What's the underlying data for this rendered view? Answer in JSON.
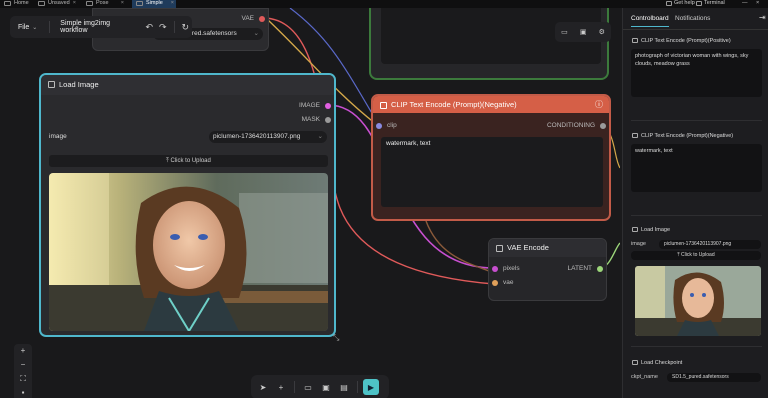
{
  "tabs": [
    {
      "label": "Home",
      "active": false
    },
    {
      "label": "Unsaved",
      "active": false
    },
    {
      "label": "Pose",
      "active": false
    },
    {
      "label": "Simple",
      "active": true
    }
  ],
  "top_right": {
    "help": "Get help",
    "terminal": "Terminal"
  },
  "menu": {
    "file_label": "File",
    "workflow_name": "Simple img2img workflow"
  },
  "checkpoint_node": {
    "vae_label": "VAE",
    "ckpt_label": "ckpt_name",
    "ckpt_value": "SD1.5_pured.safetensors"
  },
  "load_image_node": {
    "title": "Load Image",
    "outputs": [
      "IMAGE",
      "MASK"
    ],
    "image_label": "image",
    "image_value": "piclumen-1736420113907.png",
    "upload_label": "Click to Upload"
  },
  "clip_node": {
    "title": "CLIP Text Encode (Prompt)(Negative)",
    "input": "clip",
    "output": "CONDITIONING",
    "text": "watermark, text"
  },
  "vae_node": {
    "title": "VAE Encode",
    "inputs": [
      "pixels",
      "vae"
    ],
    "output": "LATENT"
  },
  "panel": {
    "tabs": [
      "Controlboard",
      "Notifications"
    ],
    "pos_title": "CLIP Text Encode (Prompt)(Positive)",
    "pos_text": "photograph of victorian woman with wings, sky clouds, meadow grass",
    "neg_title": "CLIP Text Encode (Prompt)(Negative)",
    "neg_text": "watermark, text",
    "load_title": "Load Image",
    "load_image_label": "image",
    "load_image_value": "piclumen-1736420113907.png",
    "upload_label": "Click to Upload",
    "ckpt_title": "Load Checkpoint",
    "ckpt_label": "ckpt_name",
    "ckpt_value": "SD1.5_pured.safetensors"
  },
  "colors": {
    "image_link": "#c84fd0",
    "clip_link": "#d4a84a",
    "vae_link": "#e05a5a",
    "latent": "#9cd67a",
    "load_border": "#4fb7cc",
    "clip_header": "#d55f47",
    "run_button": "#4ec3c7"
  }
}
